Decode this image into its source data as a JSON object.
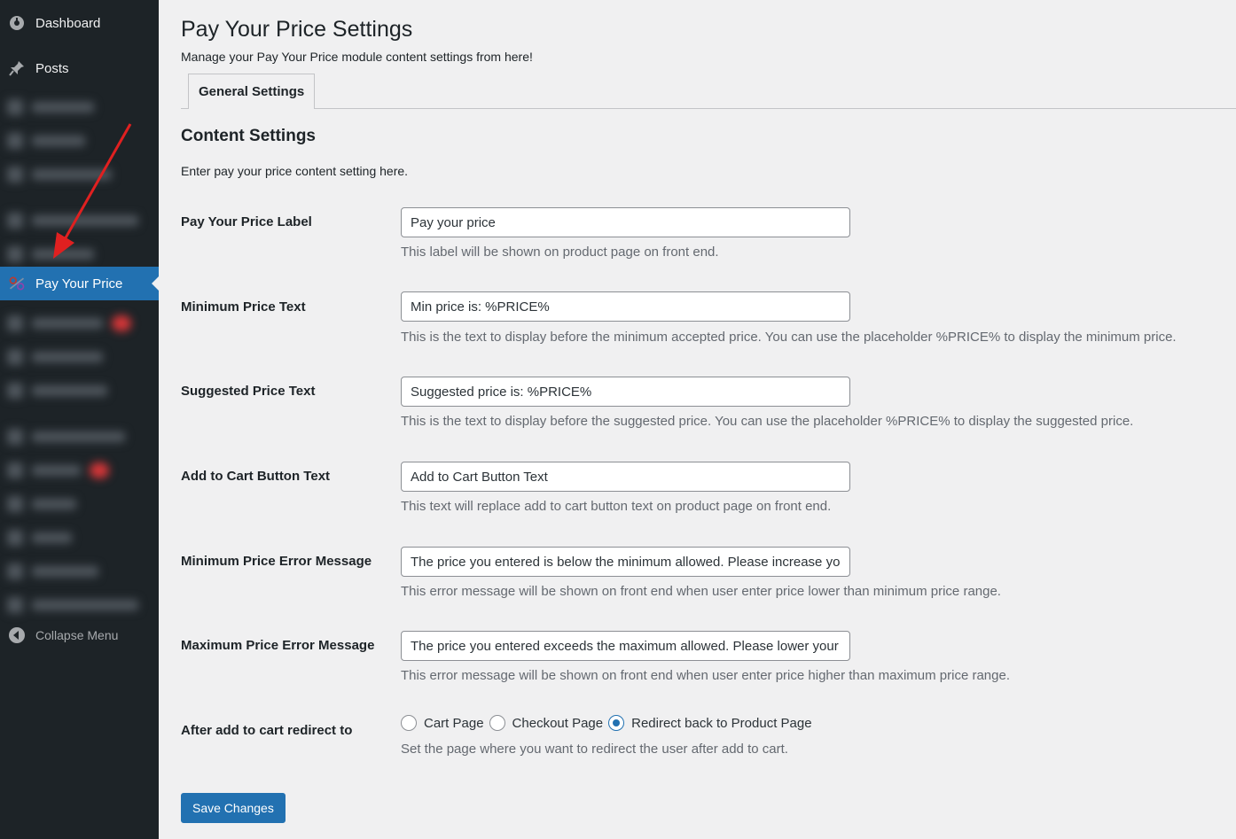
{
  "sidebar": {
    "dashboard_label": "Dashboard",
    "posts_label": "Posts",
    "active_label": "Pay Your Price",
    "collapse_label": "Collapse Menu"
  },
  "header": {
    "title": "Pay Your Price Settings",
    "subtitle": "Manage your Pay Your Price module content settings from here!"
  },
  "tabs": [
    {
      "label": "General Settings"
    }
  ],
  "section": {
    "title": "Content Settings",
    "description": "Enter pay your price content setting here."
  },
  "fields": {
    "label": {
      "label": "Pay Your Price Label",
      "value": "Pay your price",
      "help": "This label will be shown on product page on front end."
    },
    "min_price": {
      "label": "Minimum Price Text",
      "value": "Min price is: %PRICE%",
      "help": "This is the text to display before the minimum accepted price. You can use the placeholder %PRICE% to display the minimum price."
    },
    "suggested_price": {
      "label": "Suggested Price Text",
      "value": "Suggested price is: %PRICE%",
      "help": "This is the text to display before the suggested price. You can use the placeholder %PRICE% to display the suggested price."
    },
    "add_to_cart": {
      "label": "Add to Cart Button Text",
      "value": "Add to Cart Button Text",
      "help": "This text will replace add to cart button text on product page on front end."
    },
    "min_error": {
      "label": "Minimum Price Error Message",
      "value": "The price you entered is below the minimum allowed. Please increase your price.",
      "help": "This error message will be shown on front end when user enter price lower than minimum price range."
    },
    "max_error": {
      "label": "Maximum Price Error Message",
      "value": "The price you entered exceeds the maximum allowed. Please lower your price.",
      "help": "This error message will be shown on front end when user enter price higher than maximum price range."
    }
  },
  "redirect": {
    "label": "After add to cart redirect to",
    "options": [
      "Cart Page",
      "Checkout Page",
      "Redirect back to Product Page"
    ],
    "selected": "Redirect back to Product Page",
    "help": "Set the page where you want to redirect the user after add to cart."
  },
  "save_label": "Save Changes",
  "colors": {
    "sidebar_bg": "#1d2327",
    "accent": "#2271b1",
    "annotation_arrow": "#e02020"
  }
}
